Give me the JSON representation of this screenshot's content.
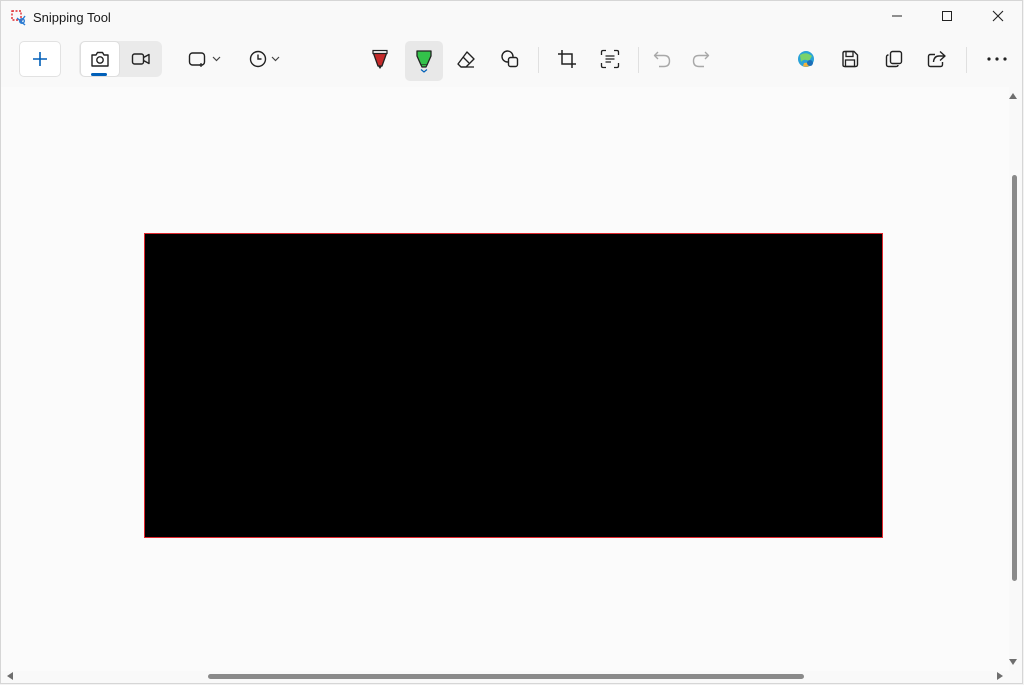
{
  "window": {
    "title": "Snipping Tool",
    "app_icon": "snipping-tool-icon",
    "controls": [
      "minimize-icon",
      "maximize-icon",
      "close-icon"
    ]
  },
  "toolbar": {
    "new_button_icon": "plus-icon",
    "capture_modes": [
      {
        "icon": "camera-icon",
        "selected": true
      },
      {
        "icon": "video-camera-icon",
        "selected": false
      }
    ],
    "snip_shape_icon": "rectangle-snip-icon",
    "delay_icon": "clock-icon",
    "ink_tools": [
      {
        "icon": "ballpoint-pen-icon",
        "color": "#c42b2b",
        "active": false
      },
      {
        "icon": "highlighter-icon",
        "color": "#33c24a",
        "active": true
      },
      {
        "icon": "eraser-icon",
        "active": false
      },
      {
        "icon": "shapes-icon",
        "active": false
      }
    ],
    "crop_icon": "crop-icon",
    "text_actions_icon": "text-actions-icon",
    "undo_icon": "undo-icon",
    "redo_icon": "redo-icon",
    "right_actions": [
      "paint-3d-icon",
      "save-icon",
      "copy-icon",
      "share-icon",
      "more-icon"
    ],
    "accent_color": "#005fb8"
  },
  "canvas": {
    "snip_fill": "#000000",
    "snip_border": "#e0282e"
  }
}
